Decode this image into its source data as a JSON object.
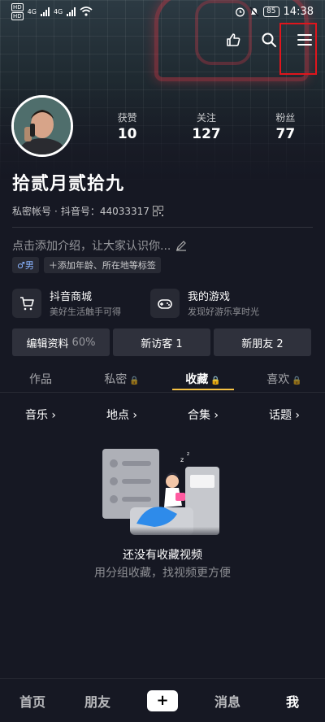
{
  "status_bar": {
    "time": "14:38",
    "battery": "85",
    "net1": "4G",
    "net2": "4G"
  },
  "profile": {
    "name": "拾贰月贰拾九",
    "private_label": "私密帐号",
    "douyin_id_label": "抖音号：44033317",
    "intro_placeholder": "点击添加介绍，让大家认识你...",
    "gender_tag": "♂男",
    "add_tag": "添加年龄、所在地等标签"
  },
  "stats": [
    {
      "label": "获赞",
      "value": "10"
    },
    {
      "label": "关注",
      "value": "127"
    },
    {
      "label": "粉丝",
      "value": "77"
    }
  ],
  "shortcuts": [
    {
      "title": "抖音商城",
      "subtitle": "美好生活触手可得"
    },
    {
      "title": "我的游戏",
      "subtitle": "发现好游乐享时光"
    }
  ],
  "buttons": {
    "edit": "编辑资料",
    "edit_percent": "60%",
    "visitors": "新访客 1",
    "friends": "新朋友 2"
  },
  "tabs": [
    {
      "label": "作品"
    },
    {
      "label": "私密"
    },
    {
      "label": "收藏"
    },
    {
      "label": "喜欢"
    }
  ],
  "categories": [
    {
      "label": "音乐"
    },
    {
      "label": "地点"
    },
    {
      "label": "合集"
    },
    {
      "label": "话题"
    }
  ],
  "empty": {
    "title": "还没有收藏视频",
    "subtitle": "用分组收藏，找视频更方便"
  },
  "bottom_nav": {
    "home": "首页",
    "friends": "朋友",
    "plus": "+",
    "messages": "消息",
    "me": "我"
  },
  "colors": {
    "accent": "#f6c244",
    "highlight_box": "#e0151c",
    "background": "#161823"
  }
}
